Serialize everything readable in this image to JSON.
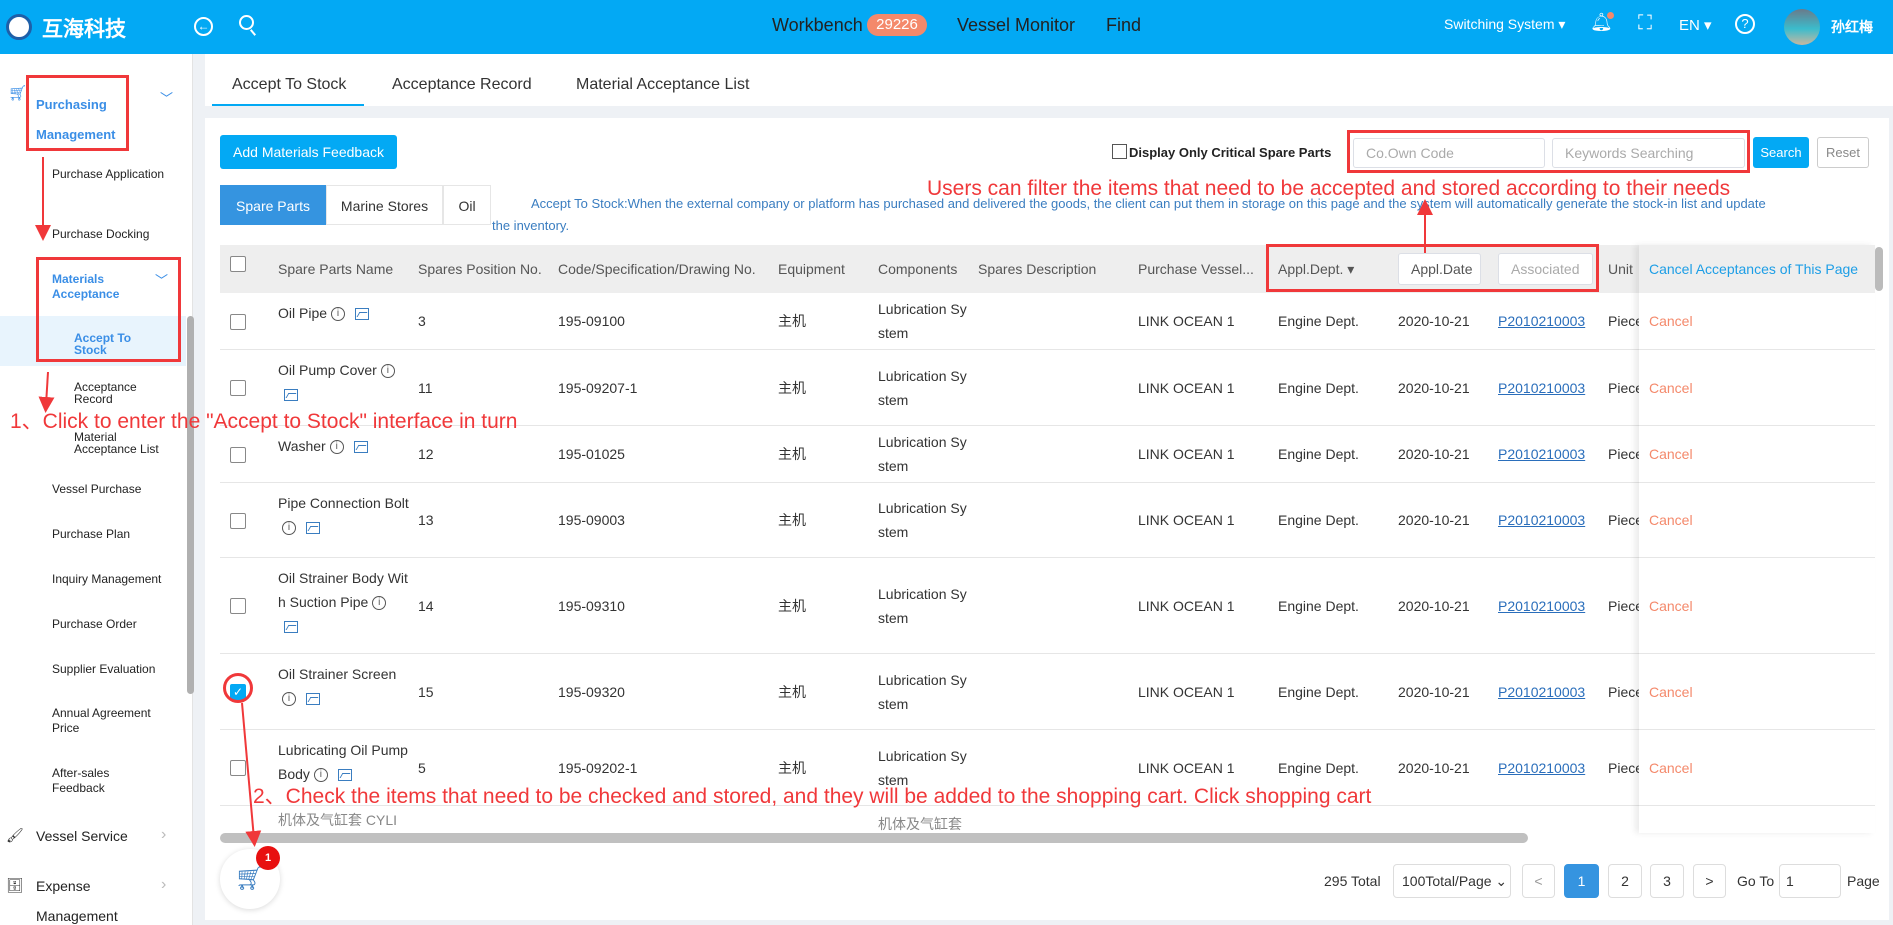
{
  "header": {
    "brand": "互海科技",
    "nav": [
      "Workbench",
      "Vessel Monitor",
      "Find"
    ],
    "workbench_count": "29226",
    "switch_system": "Switching System",
    "language": "EN",
    "user_name": "孙红梅",
    "accent": "#03a9f4"
  },
  "sidebar": {
    "purchasing": "Purchasing Management",
    "items": [
      "Purchase Application",
      "Purchase Docking"
    ],
    "materials": "Materials Acceptance",
    "sub": [
      "Accept To Stock",
      "Acceptance Record",
      "Material Acceptance List"
    ],
    "items2": [
      "Vessel Purchase",
      "Purchase Plan",
      "Inquiry Management",
      "Purchase Order",
      "Supplier Evaluation",
      "Annual Agreement Price",
      "After-sales Feedback"
    ],
    "vessel_service": "Vessel Service",
    "expense": "Expense",
    "expense2": "Management"
  },
  "tabs": [
    "Accept To Stock",
    "Acceptance Record",
    "Material Acceptance List"
  ],
  "toolbar": {
    "add_feedback": "Add Materials Feedback",
    "critical_only": "Display Only Critical Spare Parts",
    "co_own_placeholder": "Co.Own Code",
    "keywords_placeholder": "Keywords Searching",
    "search": "Search",
    "reset": "Reset"
  },
  "subtabs": [
    "Spare Parts",
    "Marine Stores",
    "Oil"
  ],
  "info_text": "Accept To Stock:When the external company or platform has purchased and delivered the goods, the client can put them in storage on this page and the system will automatically generate the stock-in list and update",
  "info_text2": "the inventory.",
  "annotations": {
    "filter": "Users can filter the items that need to be accepted and stored according to their needs",
    "step1": "1、Click to enter the \"Accept to Stock\" interface in turn",
    "step2": "2、Check the items that need to be checked and stored, and they will be added to the shopping cart. Click shopping cart"
  },
  "table": {
    "columns": [
      "Spare Parts Name",
      "Spares Position No.",
      "Code/Specification/Drawing No.",
      "Equipment",
      "Components",
      "Spares Description",
      "Purchase Vessel...",
      "Appl.Dept.",
      "Appl.Date",
      "Associated",
      "Unit",
      "Cancel Acceptances of This Page"
    ],
    "rows": [
      {
        "name": "Oil Pipe",
        "pos": "3",
        "code": "195-09100",
        "equip": "主机",
        "comp": "Lubrication System",
        "vessel": "LINK OCEAN 1",
        "dept": "Engine Dept.",
        "date": "2020-10-21",
        "assoc": "P2010210003",
        "unit": "Piece",
        "action": "Cancel",
        "checked": false
      },
      {
        "name": "Oil Pump Cover",
        "pos": "11",
        "code": "195-09207-1",
        "equip": "主机",
        "comp": "Lubrication System",
        "vessel": "LINK OCEAN 1",
        "dept": "Engine Dept.",
        "date": "2020-10-21",
        "assoc": "P2010210003",
        "unit": "Piece",
        "action": "Cancel",
        "checked": false
      },
      {
        "name": "Washer",
        "pos": "12",
        "code": "195-01025",
        "equip": "主机",
        "comp": "Lubrication System",
        "vessel": "LINK OCEAN 1",
        "dept": "Engine Dept.",
        "date": "2020-10-21",
        "assoc": "P2010210003",
        "unit": "Piece",
        "action": "Cancel",
        "checked": false
      },
      {
        "name": "Pipe Connection Bolt",
        "pos": "13",
        "code": "195-09003",
        "equip": "主机",
        "comp": "Lubrication System",
        "vessel": "LINK OCEAN 1",
        "dept": "Engine Dept.",
        "date": "2020-10-21",
        "assoc": "P2010210003",
        "unit": "Piece",
        "action": "Cancel",
        "checked": false
      },
      {
        "name": "Oil Strainer Body With Suction Pipe",
        "pos": "14",
        "code": "195-09310",
        "equip": "主机",
        "comp": "Lubrication System",
        "vessel": "LINK OCEAN 1",
        "dept": "Engine Dept.",
        "date": "2020-10-21",
        "assoc": "P2010210003",
        "unit": "Piece",
        "action": "Cancel",
        "checked": false
      },
      {
        "name": "Oil Strainer Screen",
        "pos": "15",
        "code": "195-09320",
        "equip": "主机",
        "comp": "Lubrication System",
        "vessel": "LINK OCEAN 1",
        "dept": "Engine Dept.",
        "date": "2020-10-21",
        "assoc": "P2010210003",
        "unit": "Piece",
        "action": "Cancel",
        "checked": true
      },
      {
        "name": "Lubricating Oil Pump Body",
        "pos": "5",
        "code": "195-09202-1",
        "equip": "主机",
        "comp": "Lubrication System",
        "vessel": "LINK OCEAN 1",
        "dept": "Engine Dept.",
        "date": "2020-10-21",
        "assoc": "P2010210003",
        "unit": "Piece",
        "action": "Cancel",
        "checked": false
      }
    ],
    "partial_row": {
      "name": "机体及气缸套 CYLI",
      "comp": "机体及气缸套"
    }
  },
  "cart": {
    "count": "1"
  },
  "pagination": {
    "total": "295 Total",
    "page_size": "100Total/Page",
    "pages": [
      "1",
      "2",
      "3"
    ],
    "current": "1",
    "prev": "<",
    "next": ">",
    "goto_label": "Go To",
    "goto_value": "1",
    "page_label": "Page"
  }
}
